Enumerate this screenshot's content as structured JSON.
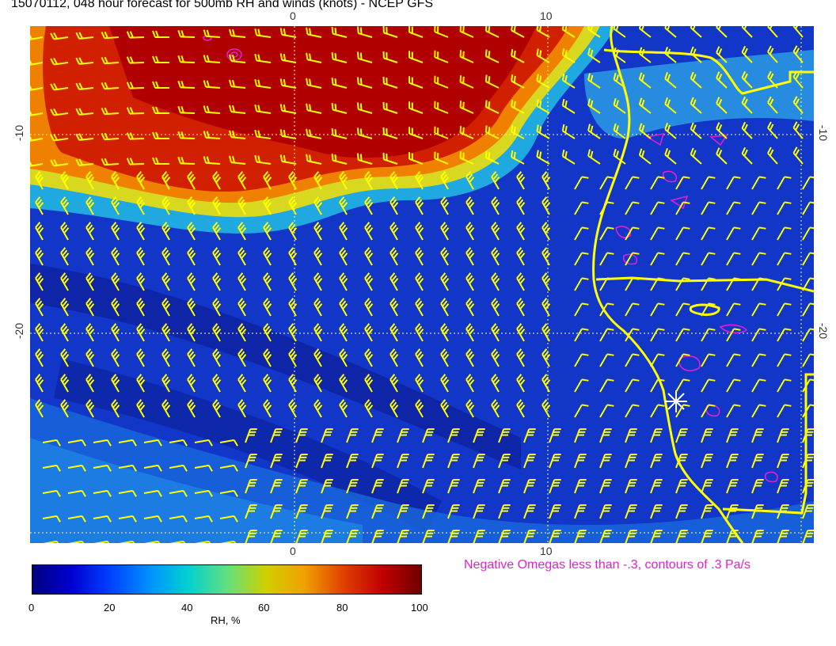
{
  "title": "15070112, 048 hour forecast for 500mb RH and winds (knots) - NCEP GFS",
  "axes": {
    "top_ticks": [
      "0",
      "10"
    ],
    "bottom_ticks": [
      "0",
      "10"
    ],
    "left_ticks": [
      "-10",
      "-20"
    ],
    "right_ticks": [
      "-10",
      "-20"
    ]
  },
  "omega_note": "Negative Omegas less than -.3, contours of .3 Pa/s",
  "colorbar": {
    "labels": [
      "0",
      "20",
      "40",
      "60",
      "80",
      "100"
    ],
    "title": "RH, %"
  },
  "colors": {
    "coastline": "#ffff00",
    "wind_barbs": "#ffff00",
    "omega_contours": "#e020d0",
    "gridlines": "#ffff80"
  },
  "icons": [
    "wind-barb-icon",
    "star-marker-icon"
  ]
}
